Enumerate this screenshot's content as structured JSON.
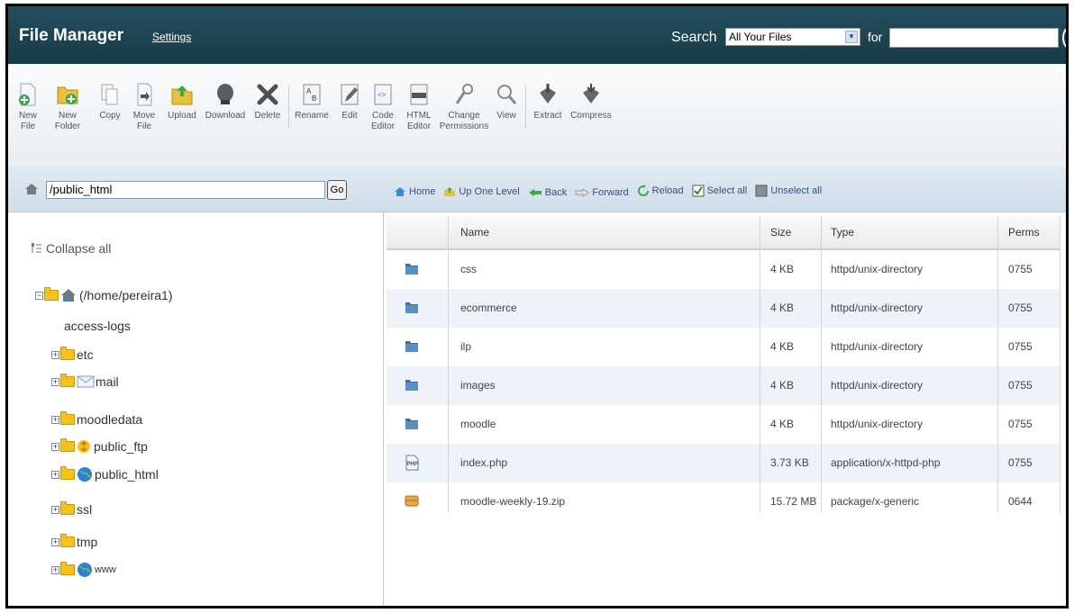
{
  "header": {
    "title": "File Manager",
    "settings_link": "Settings",
    "search_label": "Search",
    "search_scope": "All Your Files",
    "for_label": "for",
    "search_query": ""
  },
  "toolbar": {
    "buttons": [
      {
        "label1": "New File",
        "label2": "",
        "icon": "new-file-icon"
      },
      {
        "label1": "New",
        "label2": "Folder",
        "icon": "new-folder-icon"
      },
      {
        "label1": "Copy",
        "label2": "",
        "icon": "copy-icon"
      },
      {
        "label1": "Move",
        "label2": "File",
        "icon": "move-file-icon"
      },
      {
        "label1": "Upload",
        "label2": "",
        "icon": "upload-icon"
      },
      {
        "label1": "Download",
        "label2": "",
        "icon": "download-icon"
      },
      {
        "label1": "Delete",
        "label2": "",
        "icon": "delete-icon"
      },
      {
        "label1": "Rename",
        "label2": "",
        "icon": "rename-icon"
      },
      {
        "label1": "Edit",
        "label2": "",
        "icon": "edit-icon"
      },
      {
        "label1": "Code",
        "label2": "Editor",
        "icon": "code-editor-icon"
      },
      {
        "label1": "HTML",
        "label2": "Editor",
        "icon": "html-editor-icon"
      },
      {
        "label1": "Change",
        "label2": "Permissions",
        "icon": "permissions-icon"
      },
      {
        "label1": "View",
        "label2": "",
        "icon": "view-icon"
      },
      {
        "label1": "Extract",
        "label2": "",
        "icon": "extract-icon"
      },
      {
        "label1": "Compress",
        "label2": "",
        "icon": "compress-icon"
      }
    ]
  },
  "pathbar": {
    "path": "/public_html",
    "go_label": "Go"
  },
  "nav": {
    "home": "Home",
    "up": "Up One Level",
    "back": "Back",
    "forward": "Forward",
    "reload": "Reload",
    "select_all": "Select all",
    "unselect_all": "Unselect all"
  },
  "tree": {
    "collapse_all": "Collapse all",
    "root": "(/home/pereira1)",
    "items": [
      "access-logs",
      "etc",
      "mail",
      "moodledata",
      "public_ftp",
      "public_html",
      "ssl",
      "tmp",
      "www"
    ]
  },
  "files": {
    "columns": [
      "Name",
      "Size",
      "Type",
      "Perms"
    ],
    "rows": [
      {
        "name": "css",
        "size": "4 KB",
        "type": "httpd/unix-directory",
        "perms": "0755",
        "kind": "folder"
      },
      {
        "name": "ecommerce",
        "size": "4 KB",
        "type": "httpd/unix-directory",
        "perms": "0755",
        "kind": "folder"
      },
      {
        "name": "ilp",
        "size": "4 KB",
        "type": "httpd/unix-directory",
        "perms": "0755",
        "kind": "folder"
      },
      {
        "name": "images",
        "size": "4 KB",
        "type": "httpd/unix-directory",
        "perms": "0755",
        "kind": "folder"
      },
      {
        "name": "moodle",
        "size": "4 KB",
        "type": "httpd/unix-directory",
        "perms": "0755",
        "kind": "folder"
      },
      {
        "name": "index.php",
        "size": "3.73 KB",
        "type": "application/x-httpd-php",
        "perms": "0755",
        "kind": "php"
      },
      {
        "name": "moodle-weekly-19.zip",
        "size": "15.72 MB",
        "type": "package/x-generic",
        "perms": "0644",
        "kind": "zip"
      }
    ]
  },
  "colors": {
    "header_bg": "#1a4553",
    "accent": "#33507a",
    "alt_row": "#eef3f9"
  }
}
